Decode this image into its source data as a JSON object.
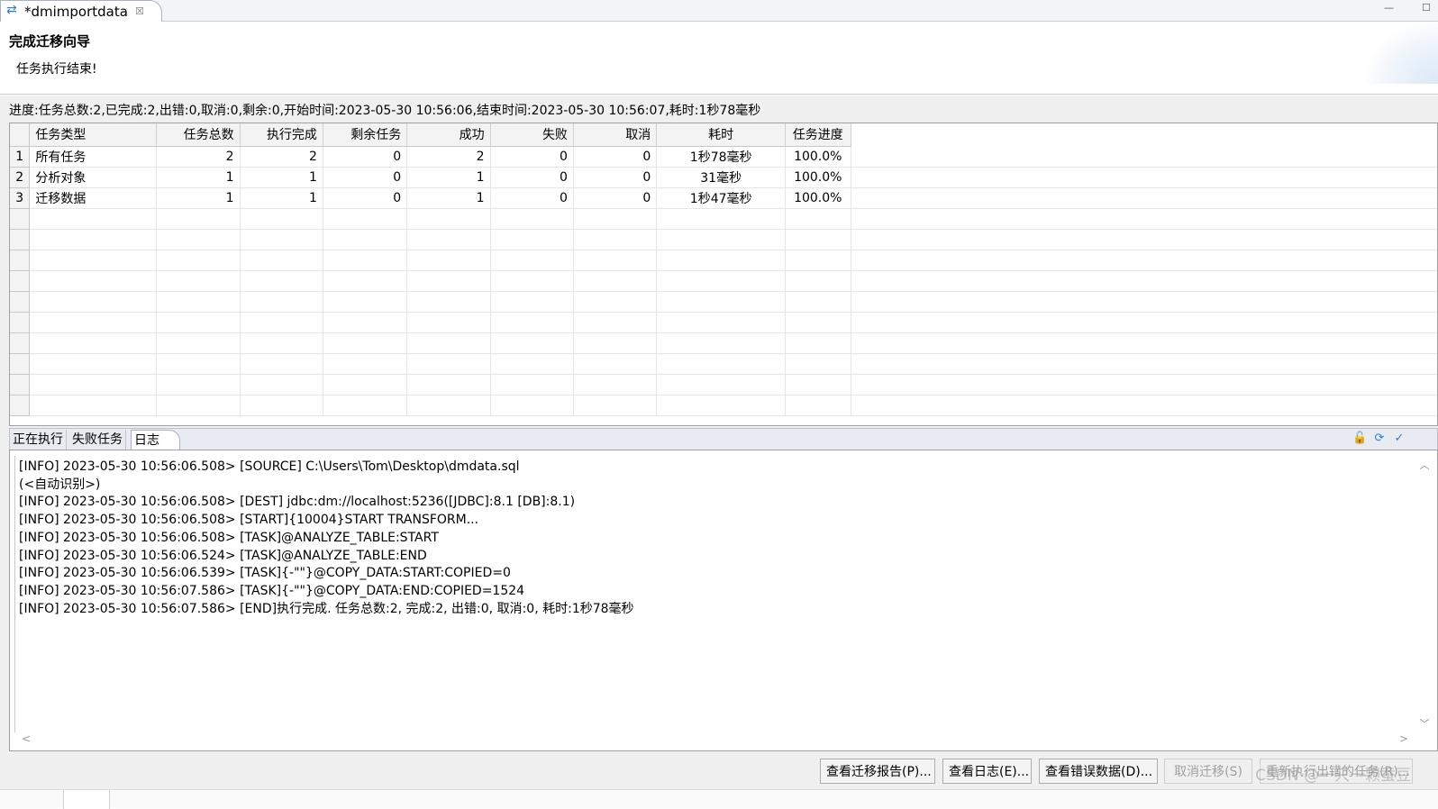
{
  "editor": {
    "tab_title": "*dmimportdata",
    "close_glyph": "☒",
    "minimize_glyph": "—",
    "maximize_glyph": "☐"
  },
  "header": {
    "title": "完成迁移向导",
    "subtitle": "任务执行结束!"
  },
  "progress": {
    "summary": "进度:任务总数:2,已完成:2,出错:0,取消:0,剩余:0,开始时间:2023-05-30 10:56:06,结束时间:2023-05-30 10:56:07,耗时:1秒78毫秒"
  },
  "table": {
    "columns": [
      "任务类型",
      "任务总数",
      "执行完成",
      "剩余任务",
      "成功",
      "失败",
      "取消",
      "耗时",
      "任务进度"
    ],
    "rows": [
      {
        "num": "1",
        "cells": [
          "所有任务",
          "2",
          "2",
          "0",
          "2",
          "0",
          "0",
          "1秒78毫秒",
          "100.0%"
        ]
      },
      {
        "num": "2",
        "cells": [
          "分析对象",
          "1",
          "1",
          "0",
          "1",
          "0",
          "0",
          "31毫秒",
          "100.0%"
        ]
      },
      {
        "num": "3",
        "cells": [
          "迁移数据",
          "1",
          "1",
          "0",
          "1",
          "0",
          "0",
          "1秒47毫秒",
          "100.0%"
        ]
      }
    ]
  },
  "log_tabs": {
    "running": "正在执行",
    "failed": "失败任务",
    "log": "日志"
  },
  "log_lines": [
    "[INFO] 2023-05-30 10:56:06.508> [SOURCE] C:\\Users\\Tom\\Desktop\\dmdata.sql",
    "(<自动识别>)",
    "[INFO] 2023-05-30 10:56:06.508> [DEST] jdbc:dm://localhost:5236([JDBC]:8.1 [DB]:8.1)",
    "[INFO] 2023-05-30 10:56:06.508> [START]{10004}START TRANSFORM...",
    "[INFO] 2023-05-30 10:56:06.508> [TASK]@ANALYZE_TABLE:START",
    "[INFO] 2023-05-30 10:56:06.524> [TASK]@ANALYZE_TABLE:END",
    "[INFO] 2023-05-30 10:56:06.539> [TASK]{-\"\"}@COPY_DATA:START:COPIED=0",
    "[INFO] 2023-05-30 10:56:07.586> [TASK]{-\"\"}@COPY_DATA:END:COPIED=1524",
    "[INFO] 2023-05-30 10:56:07.586> [END]执行完成. 任务总数:2, 完成:2, 出错:0, 取消:0, 耗时:1秒78毫秒"
  ],
  "buttons": {
    "view_report": "查看迁移报告(P)...",
    "view_log": "查看日志(E)...",
    "view_error_data": "查看错误数据(D)...",
    "cancel_migration": "取消迁移(S)",
    "rerun_failed": "重新执行出错的任务(R)..."
  },
  "watermark": "CSDN @一只一颗蚕豆"
}
